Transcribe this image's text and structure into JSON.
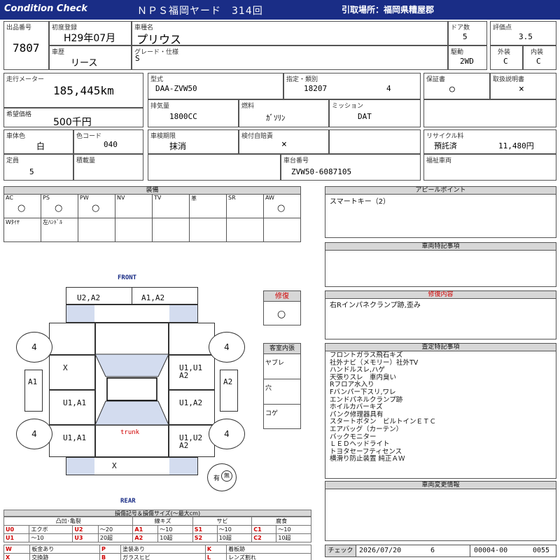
{
  "header": {
    "brand": "Condition  Check",
    "title": "ＮＰＳ福岡ヤード　314回",
    "pickup": "引取場所：福岡県糟屋郡"
  },
  "top": {
    "lot_label": "出品番号",
    "lot": "7807",
    "first_reg_label": "初度登録",
    "first_reg": "H29年07月",
    "car_name_label": "車種名",
    "car_name": "プリウス",
    "doors_label": "ドア数",
    "doors": "5",
    "score_label": "評価点",
    "score": "3.5",
    "history_label": "車歴",
    "history": "リース",
    "grade_label": "グレード・仕様",
    "grade": "S",
    "drive_label": "駆動",
    "drive": "2WD",
    "exterior_label": "外装",
    "exterior": "C",
    "interior_label": "内装",
    "interior": "C"
  },
  "specs": {
    "mileage_label": "走行メーター",
    "mileage": "185,445km",
    "price_label": "希望価格",
    "price": "500千円",
    "model_label": "型式",
    "model": "DAA-ZVW50",
    "spec_label": "指定・類別",
    "spec1": "18207",
    "spec2": "4",
    "warranty_label": "保証書",
    "warranty": "○",
    "manual_label": "取扱説明書",
    "manual": "×",
    "displacement_label": "排気量",
    "displacement": "1800CC",
    "fuel_label": "燃料",
    "fuel": "ｶﾞｿﾘﾝ",
    "mission_label": "ミッション",
    "mission": "DAT",
    "color_label": "車体色",
    "color": "白",
    "color_code_label": "色コード",
    "color_code": "040",
    "inspection_label": "車検期限",
    "inspection": "抹消",
    "liability_label": "検付自賠責",
    "liability": "×",
    "recycle_label": "リサイクル料",
    "recycle_status": "預託済",
    "recycle_fee": "11,480円",
    "capacity_label": "定員",
    "capacity": "5",
    "load_label": "積載量",
    "load": "",
    "chassis_label": "車台番号",
    "chassis": "ZVW50-6087105",
    "welfare_label": "福祉車両"
  },
  "equipment": {
    "title": "装備",
    "row1": [
      {
        "label": "AC",
        "mark": "○"
      },
      {
        "label": "PS",
        "mark": "○"
      },
      {
        "label": "PW",
        "mark": "○"
      },
      {
        "label": "NV",
        "mark": ""
      },
      {
        "label": "TV",
        "mark": ""
      },
      {
        "label": "革",
        "mark": ""
      },
      {
        "label": "SR",
        "mark": ""
      },
      {
        "label": "AW",
        "mark": "○"
      }
    ],
    "row2": [
      "Wﾀｲﾔ",
      "左ﾊﾝﾄﾞﾙ",
      "",
      "",
      "",
      "",
      ""
    ]
  },
  "appeal": {
    "title": "アピールポイント",
    "text": "スマートキー（2）"
  },
  "special": {
    "title": "車両特記事項",
    "text": ""
  },
  "repair": {
    "title": "修復内容",
    "text": "右Rインパネクランプ跡,歪み",
    "box_label": "修復",
    "box_mark": "○"
  },
  "interior_box": {
    "title": "客室内張",
    "rows": [
      "ヤブレ",
      "穴",
      "コゲ"
    ]
  },
  "inspection_notes": {
    "title": "査定特記事項",
    "items": [
      "フロントガラス飛石キズ",
      "社外ナビ（メモリー）社外TV",
      "ハンドルスレ,ハゲ",
      "天張りスレ　車内臭い",
      "Rフロア水入り",
      "Fバンパー下スリ,ワレ",
      "エンドパネルクランプ跡",
      "ホイルカバーキズ",
      "パンク修理器具有",
      "スタートボタン　ビルトインＥＴＣ",
      "エアバッグ（カーテン）",
      "バックモニター",
      "ＬＥＤヘッドライト",
      "トヨタセーフティセンス",
      "横滑り防止装置 純正ＡＷ"
    ]
  },
  "change_info": {
    "title": "車両変更情報"
  },
  "diagram": {
    "front": "FRONT",
    "rear": "REAR",
    "trunk": "trunk",
    "marks": {
      "front_left": "U2,A2",
      "front_right": "A1,A2",
      "left_door_front": "X",
      "right_door_front_1": "U1,U1",
      "right_door_front_2": "A2",
      "left_door_rear": "U1,A1",
      "right_door_rear": "U1,A2",
      "left_quarter": "U1,A1",
      "right_quarter_1": "U1,U2",
      "right_quarter_2": "A2",
      "rear_center": "X",
      "left_mirror": "A1",
      "right_mirror": "A2",
      "tire_fl": "4",
      "tire_fr": "4",
      "tire_rl": "4",
      "tire_rr": "4"
    },
    "spare": "有",
    "spare_inner": "無"
  },
  "legend": {
    "title": "損傷記号＆損傷サイズ(～最大cm)",
    "headers": [
      "凸凹･亀裂",
      "線キズ",
      "サビ",
      "腐食"
    ],
    "rows": [
      [
        "U0",
        "エクボ",
        "U2",
        "～20",
        "A1",
        "～10",
        "S1",
        "～10",
        "C1",
        "～10"
      ],
      [
        "U1",
        "～10",
        "U3",
        "20超",
        "A2",
        "10超",
        "S2",
        "10超",
        "C2",
        "10超"
      ]
    ],
    "bottom": [
      [
        "W",
        "板金あり",
        "P",
        "塗装あり",
        "K",
        "着板跡"
      ],
      [
        "X",
        "交換跡",
        "B",
        "ガラスヒビ",
        "L",
        "レンズ割れ"
      ]
    ]
  },
  "footer": {
    "check_label": "チェック",
    "date": "2026/07/20",
    "num": "6",
    "code1": "00004-00",
    "code2": "0055"
  }
}
